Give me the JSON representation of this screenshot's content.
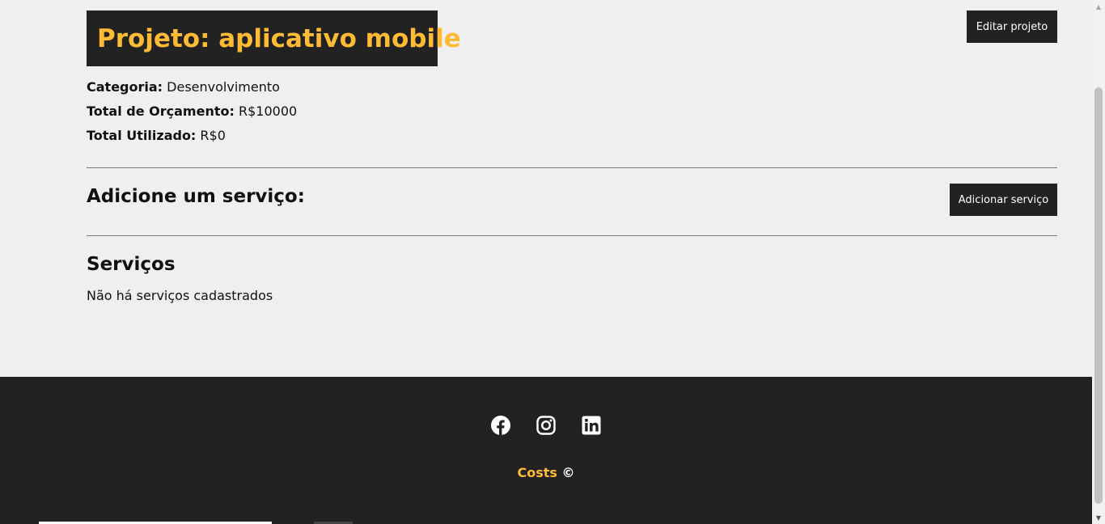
{
  "project": {
    "title": "Projeto: aplicativo mobile",
    "edit_button": "Editar projeto",
    "category_label": "Categoria:",
    "category_value": "Desenvolvimento",
    "budget_label": "Total de Orçamento:",
    "budget_value": "R$10000",
    "used_label": "Total Utilizado:",
    "used_value": "R$0"
  },
  "add_service": {
    "title": "Adicione um serviço:",
    "button": "Adicionar serviço"
  },
  "services": {
    "title": "Serviços",
    "empty_message": "Não há serviços cadastrados"
  },
  "footer": {
    "social": [
      "facebook-icon",
      "instagram-icon",
      "linkedin-icon"
    ],
    "brand": "Costs",
    "copyright_symbol": "©"
  },
  "colors": {
    "accent": "#ffbb33",
    "dark": "#222222",
    "background": "#efefef"
  }
}
